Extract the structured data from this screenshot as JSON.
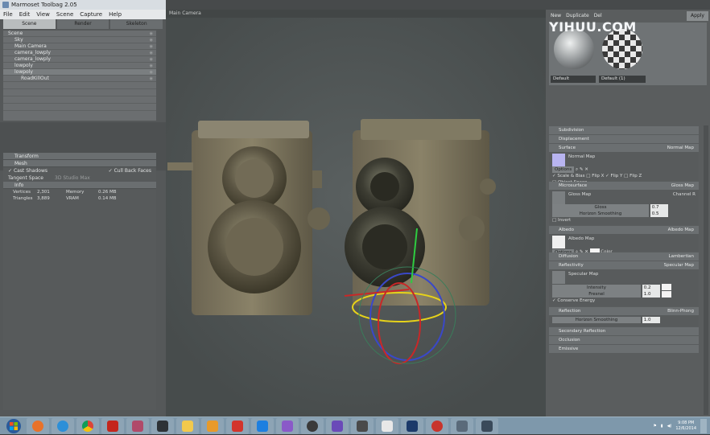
{
  "app": {
    "title": "Marmoset Toolbag 2.05"
  },
  "menu": [
    "File",
    "Edit",
    "View",
    "Scene",
    "Capture",
    "Help"
  ],
  "left_tabs": [
    "Scene",
    "Render",
    "Skeleton"
  ],
  "outliner": [
    {
      "label": "Scene",
      "indent": 0
    },
    {
      "label": "Sky",
      "indent": 1
    },
    {
      "label": "Main Camera",
      "indent": 1
    },
    {
      "label": "camera_lowply",
      "indent": 1
    },
    {
      "label": "camera_lowply",
      "indent": 1
    },
    {
      "label": "lowpoly",
      "indent": 1
    },
    {
      "label": "lowpoly",
      "indent": 1
    },
    {
      "label": "RoadKillOut",
      "indent": 2
    }
  ],
  "transform": {
    "header": "Transform",
    "mesh_header": "Mesh",
    "cast_shadows": "Cast Shadows",
    "cull_back_faces": "Cull Back Faces",
    "tangent_space_label": "Tangent Space",
    "tangent_space_value": "3D Studio Max",
    "info_header": "Info",
    "info": [
      {
        "k1": "Vertices",
        "v1": "2,301",
        "k2": "Memory",
        "v2": "0.26 MB"
      },
      {
        "k1": "Triangles",
        "v1": "3,889",
        "k2": "VRAM",
        "v2": "0.14 MB"
      }
    ]
  },
  "viewport": {
    "tab": "Main Camera"
  },
  "material": {
    "top": [
      "New",
      "Duplicate",
      "Del"
    ],
    "apply": "Apply",
    "balls": [
      "Default",
      "Default (1)"
    ],
    "watermark": "YIHUU.COM",
    "sections": [
      {
        "name": "Subdivision",
        "right": ""
      },
      {
        "name": "Displacement",
        "right": ""
      },
      {
        "name": "Surface",
        "right": "Normal Map"
      },
      {
        "name": "Microsurface",
        "right": "Gloss Map"
      },
      {
        "name": "Albedo",
        "right": "Albedo Map"
      },
      {
        "name": "Diffusion",
        "right": "Lambertian"
      },
      {
        "name": "Reflectivity",
        "right": "Specular Map"
      },
      {
        "name": "Reflection",
        "right": "Blinn-Phong"
      },
      {
        "name": "Secondary Reflection",
        "right": ""
      },
      {
        "name": "Occlusion",
        "right": ""
      },
      {
        "name": "Emissive",
        "right": ""
      }
    ],
    "surface": {
      "slot": "Normal Map",
      "options": "Options",
      "flags": [
        "Scale & Bias",
        "Flip X",
        "Flip Y",
        "Flip Z"
      ],
      "object_space": "Object Space"
    },
    "micro": {
      "slot": "Gloss Map",
      "channel": "Channel",
      "channel_val": "R",
      "gloss": "Gloss",
      "gloss_val": "0.7",
      "hsmooth": "Horizon Smoothing",
      "hsmooth_val": "0.5",
      "invert": "Invert"
    },
    "albedo": {
      "slot": "Albedo Map",
      "options": "Options",
      "color": "Color"
    },
    "reflect": {
      "slot": "Specular Map",
      "intensity": "Intensity",
      "intensity_val": "0.2",
      "fresnel": "Fresnel",
      "fresnel_val": "1.0",
      "conserve": "Conserve Energy"
    },
    "reflection": {
      "hscale": "Horizon",
      "smooth": "Smoothing",
      "val": "1.0"
    }
  },
  "taskbar": {
    "time": "9:08 PM",
    "date": "12/6/2014"
  },
  "colors": {
    "accent": "#7e98ab",
    "panel": "#555859"
  }
}
